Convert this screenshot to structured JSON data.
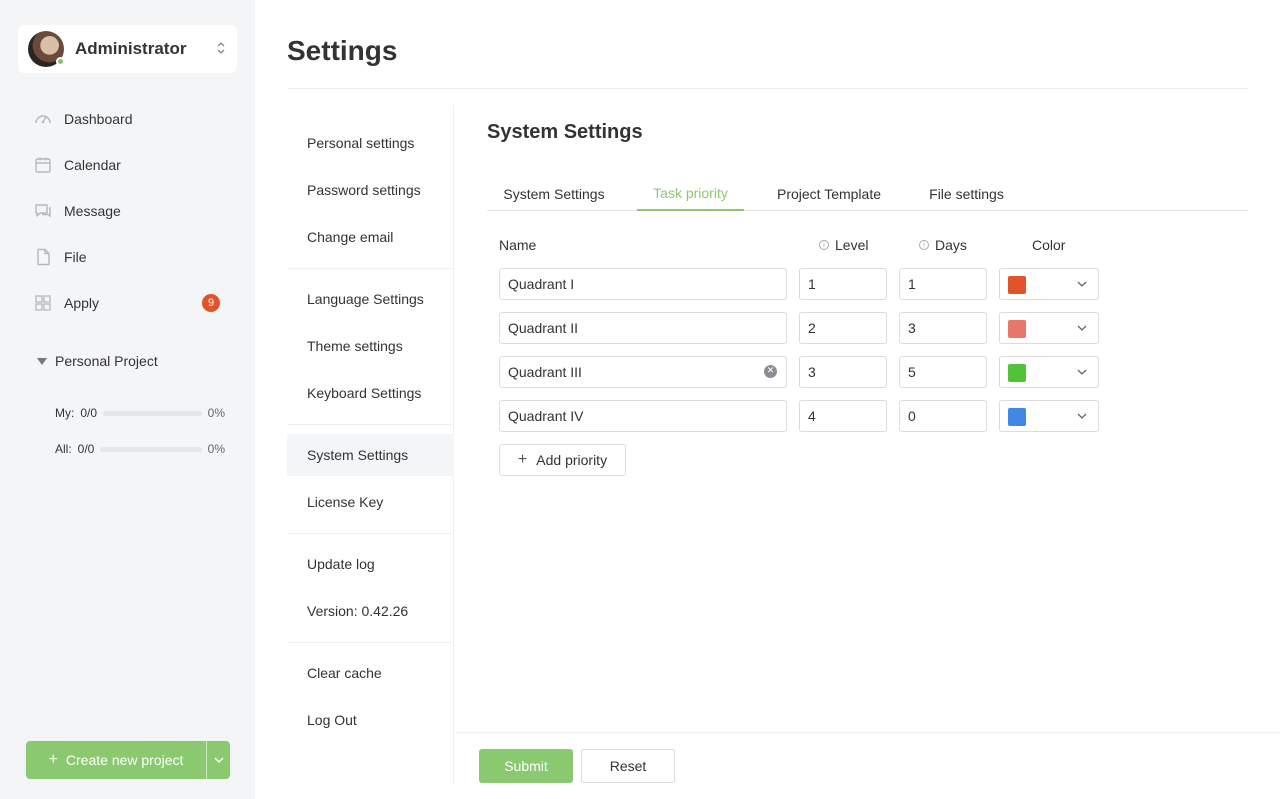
{
  "user": {
    "name": "Administrator",
    "status": "online"
  },
  "nav": {
    "items": [
      {
        "label": "Dashboard",
        "icon": "dashboard-icon"
      },
      {
        "label": "Calendar",
        "icon": "calendar-icon"
      },
      {
        "label": "Message",
        "icon": "message-icon"
      },
      {
        "label": "File",
        "icon": "file-icon"
      },
      {
        "label": "Apply",
        "icon": "apps-icon",
        "badge": "9"
      }
    ]
  },
  "personal_project": {
    "title": "Personal Project",
    "my": {
      "label": "My:",
      "count": "0/0",
      "percent": "0%"
    },
    "all": {
      "label": "All:",
      "count": "0/0",
      "percent": "0%"
    }
  },
  "create_button": {
    "label": "Create new project"
  },
  "page": {
    "title": "Settings"
  },
  "menu": {
    "personal": "Personal settings",
    "password": "Password settings",
    "email": "Change email",
    "language": "Language Settings",
    "theme": "Theme settings",
    "keyboard": "Keyboard Settings",
    "system": "System Settings",
    "license": "License Key",
    "update_log": "Update log",
    "version": "Version: 0.42.26",
    "clear_cache": "Clear cache",
    "logout": "Log Out"
  },
  "section": {
    "title": "System Settings"
  },
  "tabs": [
    {
      "label": "System Settings",
      "active": false
    },
    {
      "label": "Task priority",
      "active": true
    },
    {
      "label": "Project Template",
      "active": false
    },
    {
      "label": "File settings",
      "active": false
    }
  ],
  "table": {
    "headers": {
      "name": "Name",
      "level": "Level",
      "days": "Days",
      "color": "Color"
    },
    "rows": [
      {
        "name": "Quadrant I",
        "level": "1",
        "days": "1",
        "color": "#e0532b"
      },
      {
        "name": "Quadrant II",
        "level": "2",
        "days": "3",
        "color": "#e8766a"
      },
      {
        "name": "Quadrant III",
        "level": "3",
        "days": "5",
        "color": "#52c23b"
      },
      {
        "name": "Quadrant IV",
        "level": "4",
        "days": "0",
        "color": "#3f88e6"
      }
    ]
  },
  "add_button": {
    "label": "Add priority"
  },
  "actions": {
    "submit": "Submit",
    "reset": "Reset"
  },
  "colors": {
    "accent": "#8bc971",
    "badge": "#e0532b",
    "sidebar_bg": "#f4f5f7"
  }
}
